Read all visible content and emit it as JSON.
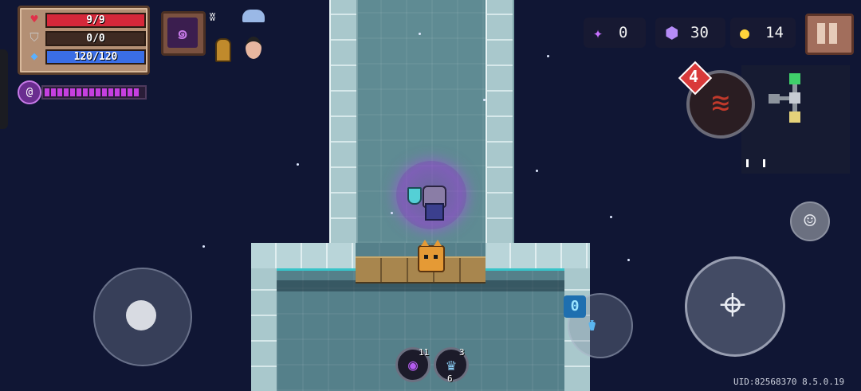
{
  "hud": {
    "stats": {
      "hp": {
        "label": "9/9",
        "color": "#d6283a",
        "icon": "heart-icon",
        "fill": 1.0
      },
      "armor": {
        "label": "0/0",
        "color": "#8a8a8a",
        "icon": "shield-icon",
        "fill": 0.0
      },
      "energy": {
        "label": "120/120",
        "color": "#3a6ee6",
        "icon": "diamond-icon",
        "fill": 1.0
      }
    },
    "buff": {
      "icon": "curse-swirl-icon",
      "segments": 15,
      "color": "#c63fe0"
    },
    "skill": {
      "icon": "swirl-skill-icon"
    },
    "status_icons": [
      "wifi-icon",
      "snail-icon",
      "helmet-icon",
      "face-icon"
    ],
    "currency": {
      "crystals": {
        "icon": "crystal-icon",
        "value": "0",
        "color": "#c670ff"
      },
      "gems": {
        "icon": "gem-icon",
        "value": "30",
        "color": "#b58cf7"
      },
      "coins": {
        "icon": "coin-icon",
        "value": "14",
        "color": "#ffd43b"
      }
    },
    "weapon": {
      "energy_cost": "4",
      "icon": "claw-icon"
    },
    "swap": {
      "ammo": "0",
      "icon": "watering-can-icon"
    },
    "items": [
      {
        "icon": "dark-orb-icon",
        "count": "11"
      },
      {
        "icon": "ice-crown-icon",
        "count_top": "3",
        "count_bottom": "6"
      }
    ],
    "uid": "UID:82568370 8.5.0.19"
  }
}
